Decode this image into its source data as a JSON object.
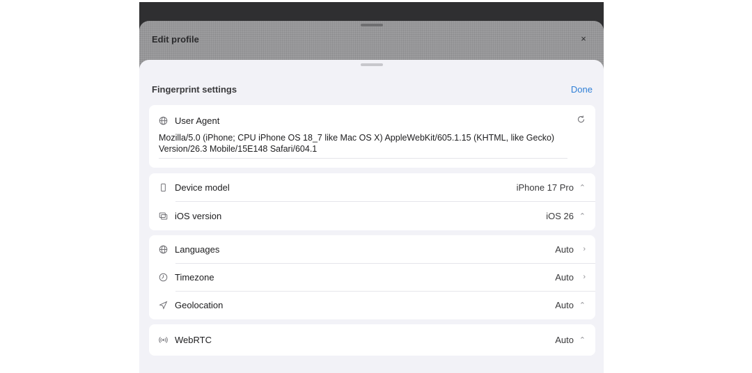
{
  "back_sheet": {
    "title": "Edit profile",
    "close_label": "×"
  },
  "sheet": {
    "title": "Fingerprint settings",
    "done_label": "Done"
  },
  "user_agent": {
    "label": "User Agent",
    "value": "Mozilla/5.0 (iPhone; CPU iPhone OS 18_7 like Mac OS X) AppleWebKit/605.1.15 (KHTML, like Gecko) Version/26.3 Mobile/15E148 Safari/604.1",
    "icon": "globe-icon",
    "action_icon": "refresh-icon"
  },
  "device_group": [
    {
      "label": "Device model",
      "value": "iPhone 17 Pro",
      "icon": "phone-icon",
      "accessory": "updown"
    },
    {
      "label": "iOS version",
      "value": "iOS 26",
      "icon": "windows-icon",
      "accessory": "updown"
    }
  ],
  "locale_group": [
    {
      "label": "Languages",
      "value": "Auto",
      "icon": "globe-icon",
      "accessory": "chevron"
    },
    {
      "label": "Timezone",
      "value": "Auto",
      "icon": "clock-icon",
      "accessory": "chevron"
    },
    {
      "label": "Geolocation",
      "value": "Auto",
      "icon": "location-arrow-icon",
      "accessory": "updown"
    }
  ],
  "webrtc_group": [
    {
      "label": "WebRTC",
      "value": "Auto",
      "icon": "antenna-icon",
      "accessory": "updown"
    }
  ],
  "colors": {
    "accent": "#2f7fd6",
    "background": "#f2f2f7"
  }
}
